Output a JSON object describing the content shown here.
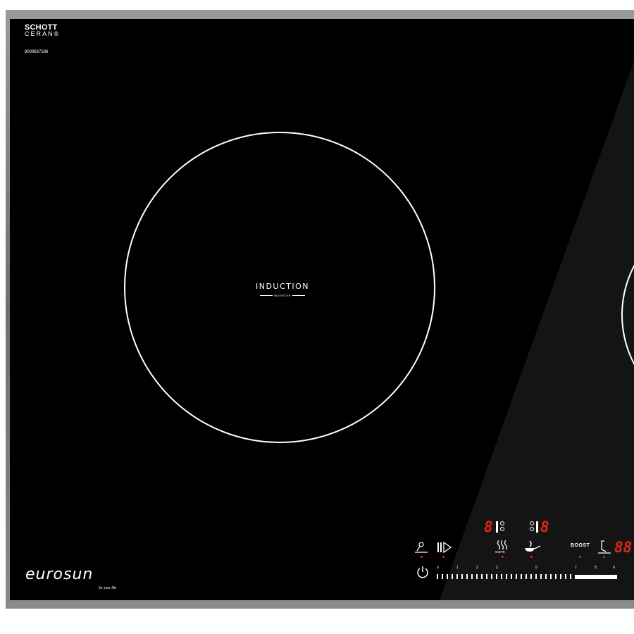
{
  "brand": {
    "schott": "SCHOTT",
    "ceran": "CERAN®",
    "serial": "8009667286"
  },
  "zone_label": {
    "title": "INDUCTION",
    "subtitle": "INVERTER"
  },
  "logo": {
    "name": "eurosun",
    "tagline": "for your life"
  },
  "controls": {
    "display_left": "8",
    "display_mid": "8",
    "display_timer": "88",
    "warm_label": "warm",
    "boost_label": "BOOST",
    "slider_labels": [
      "0",
      "1",
      "2",
      "3",
      "5",
      "7",
      "8",
      "9"
    ]
  },
  "colors": {
    "frame": "#8a8a8a",
    "glass": "#000000",
    "display_red": "#e0241b"
  }
}
